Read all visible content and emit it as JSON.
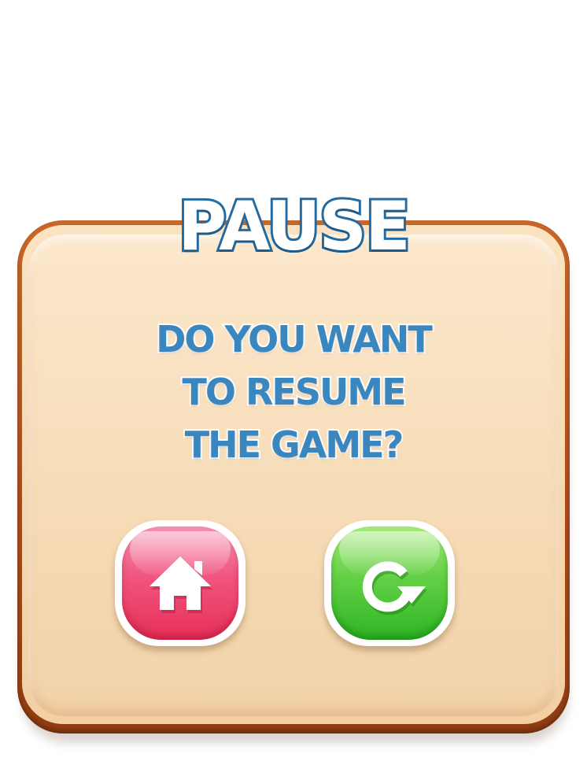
{
  "dialog": {
    "title": "PAUSE",
    "message_lines": [
      "DO YOU WANT",
      "TO RESUME",
      "THE GAME?"
    ]
  },
  "buttons": {
    "home": {
      "icon": "home-icon",
      "color": "#ef4a74"
    },
    "restart": {
      "icon": "restart-icon",
      "color": "#4cc63a"
    }
  },
  "colors": {
    "title_fill": "#ffffff",
    "title_outline": "#236aa0",
    "message_text": "#3a86be",
    "panel_fill": "#f6dcb7",
    "panel_border": "#a84a1a"
  }
}
